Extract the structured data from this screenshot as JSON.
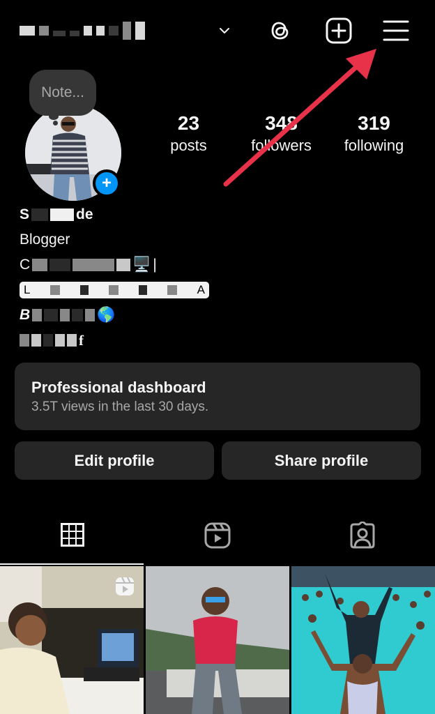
{
  "header": {
    "username_obscured": "S████ █████5",
    "username_dropdown_icon": "chevron-down-icon",
    "icons": [
      "threads-icon",
      "create-plus-icon",
      "hamburger-menu-icon"
    ]
  },
  "note": {
    "placeholder": "Note..."
  },
  "profile": {
    "add_story_icon": "plus-icon",
    "stats": [
      {
        "value": "23",
        "label": "posts"
      },
      {
        "value": "348",
        "label": "followers"
      },
      {
        "value": "319",
        "label": "following"
      }
    ]
  },
  "bio": {
    "name_visible_start": "S",
    "name_visible_end": "de",
    "category": "Blogger",
    "line1_start": "C",
    "line1_emoji": "🖥️",
    "line1_end": "|",
    "link_start": "L",
    "link_end": "A",
    "line3_start": "B",
    "line3_emoji": "🌎",
    "line4_end": "f"
  },
  "dashboard": {
    "title": "Professional dashboard",
    "subtitle": "3.5T views in the last 30 days."
  },
  "buttons": {
    "edit": "Edit profile",
    "share": "Share profile"
  },
  "tabs": [
    {
      "name": "posts-grid",
      "icon": "grid-icon",
      "active": true
    },
    {
      "name": "reels",
      "icon": "reels-icon",
      "active": false
    },
    {
      "name": "tagged",
      "icon": "tagged-person-icon",
      "active": false
    }
  ],
  "posts": [
    {
      "description": "man at laptop on desk",
      "type": "reel"
    },
    {
      "description": "man in red shirt sitting on wall, misty hills",
      "type": "photo"
    },
    {
      "description": "two men in swimming pool crowd",
      "type": "photo"
    }
  ],
  "annotation": {
    "type": "red-arrow",
    "points_to": "hamburger-menu-icon",
    "color": "#e8324a"
  },
  "colors": {
    "accent_blue": "#0095f6",
    "card_bg": "#262626",
    "secondary_text": "#a8a8a8"
  }
}
